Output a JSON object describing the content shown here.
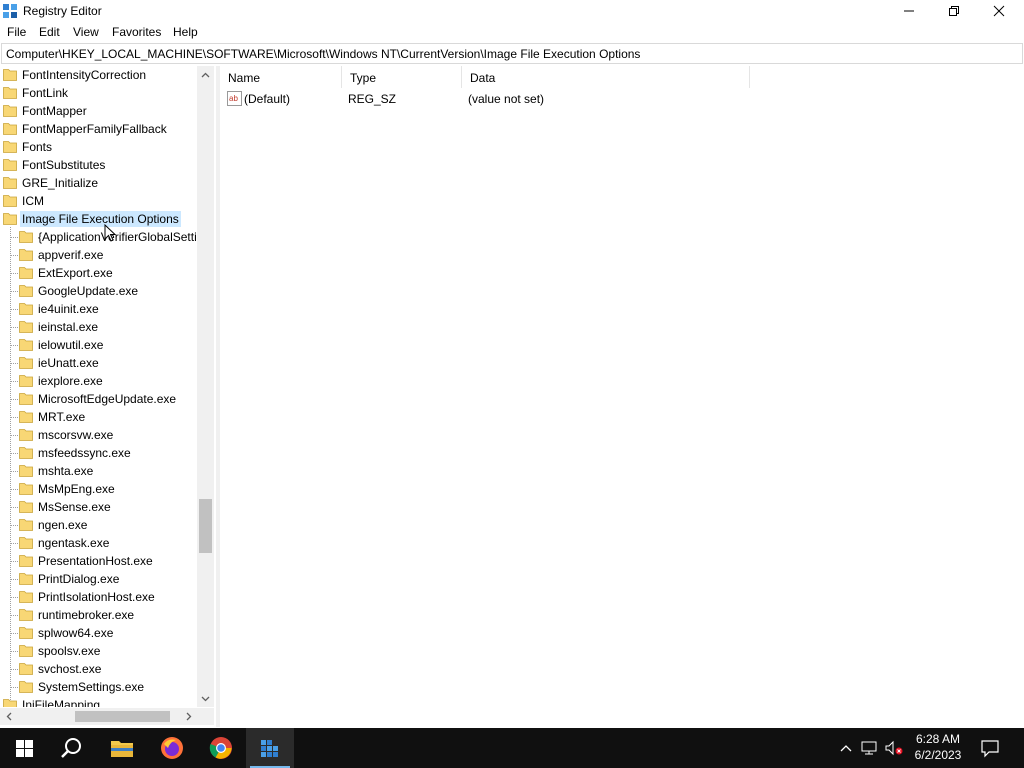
{
  "window": {
    "title": "Registry Editor"
  },
  "menu": {
    "items": [
      "File",
      "Edit",
      "View",
      "Favorites",
      "Help"
    ]
  },
  "address": {
    "path": "Computer\\HKEY_LOCAL_MACHINE\\SOFTWARE\\Microsoft\\Windows NT\\CurrentVersion\\Image File Execution Options"
  },
  "tree": {
    "items": [
      {
        "label": "FontIntensityCorrection",
        "level": 1
      },
      {
        "label": "FontLink",
        "level": 1
      },
      {
        "label": "FontMapper",
        "level": 1
      },
      {
        "label": "FontMapperFamilyFallback",
        "level": 1
      },
      {
        "label": "Fonts",
        "level": 1
      },
      {
        "label": "FontSubstitutes",
        "level": 1
      },
      {
        "label": "GRE_Initialize",
        "level": 1
      },
      {
        "label": "ICM",
        "level": 1
      },
      {
        "label": "Image File Execution Options",
        "level": 1,
        "selected": true
      },
      {
        "label": "{ApplicationVerifierGlobalSettings}",
        "level": 2
      },
      {
        "label": "appverif.exe",
        "level": 2
      },
      {
        "label": "ExtExport.exe",
        "level": 2
      },
      {
        "label": "GoogleUpdate.exe",
        "level": 2
      },
      {
        "label": "ie4uinit.exe",
        "level": 2
      },
      {
        "label": "ieinstal.exe",
        "level": 2
      },
      {
        "label": "ielowutil.exe",
        "level": 2
      },
      {
        "label": "ieUnatt.exe",
        "level": 2
      },
      {
        "label": "iexplore.exe",
        "level": 2
      },
      {
        "label": "MicrosoftEdgeUpdate.exe",
        "level": 2
      },
      {
        "label": "MRT.exe",
        "level": 2
      },
      {
        "label": "mscorsvw.exe",
        "level": 2
      },
      {
        "label": "msfeedssync.exe",
        "level": 2
      },
      {
        "label": "mshta.exe",
        "level": 2
      },
      {
        "label": "MsMpEng.exe",
        "level": 2
      },
      {
        "label": "MsSense.exe",
        "level": 2
      },
      {
        "label": "ngen.exe",
        "level": 2
      },
      {
        "label": "ngentask.exe",
        "level": 2
      },
      {
        "label": "PresentationHost.exe",
        "level": 2
      },
      {
        "label": "PrintDialog.exe",
        "level": 2
      },
      {
        "label": "PrintIsolationHost.exe",
        "level": 2
      },
      {
        "label": "runtimebroker.exe",
        "level": 2
      },
      {
        "label": "splwow64.exe",
        "level": 2
      },
      {
        "label": "spoolsv.exe",
        "level": 2
      },
      {
        "label": "svchost.exe",
        "level": 2
      },
      {
        "label": "SystemSettings.exe",
        "level": 2
      },
      {
        "label": "IniFileMapping",
        "level": 1
      }
    ]
  },
  "values": {
    "columns": [
      "Name",
      "Type",
      "Data"
    ],
    "rows": [
      {
        "name": "(Default)",
        "type": "REG_SZ",
        "data": "(value not set)"
      }
    ]
  },
  "taskbar": {
    "apps": [
      "start-icon",
      "search-icon",
      "file-explorer-icon",
      "firefox-icon",
      "chrome-icon",
      "regedit-icon"
    ],
    "clock_time": "6:28 AM",
    "clock_date": "6/2/2023"
  },
  "colors": {
    "selection": "#cce8ff",
    "taskbar": "#101010",
    "folder": "#f8d775"
  }
}
